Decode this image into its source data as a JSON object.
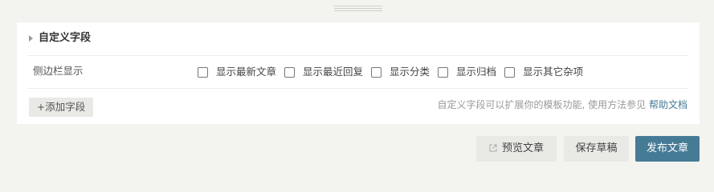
{
  "fields_panel": {
    "title": "自定义字段",
    "sidebar_row": {
      "label": "侧边栏显示",
      "options": [
        {
          "label": "显示最新文章",
          "checked": false
        },
        {
          "label": "显示最近回复",
          "checked": false
        },
        {
          "label": "显示分类",
          "checked": false
        },
        {
          "label": "显示归档",
          "checked": false
        },
        {
          "label": "显示其它杂项",
          "checked": false
        }
      ]
    },
    "add_field_label": "+添加字段",
    "hint_text": "自定义字段可以扩展你的模板功能, 使用方法参见",
    "hint_link": "帮助文档"
  },
  "actions": {
    "preview_label": "预览文章",
    "preview_icon": "external-link-icon",
    "save_draft_label": "保存草稿",
    "publish_label": "发布文章"
  },
  "colors": {
    "background": "#f3f3f0",
    "panel": "#ffffff",
    "accent": "#467b96",
    "button_gray": "#e9e9e6"
  }
}
